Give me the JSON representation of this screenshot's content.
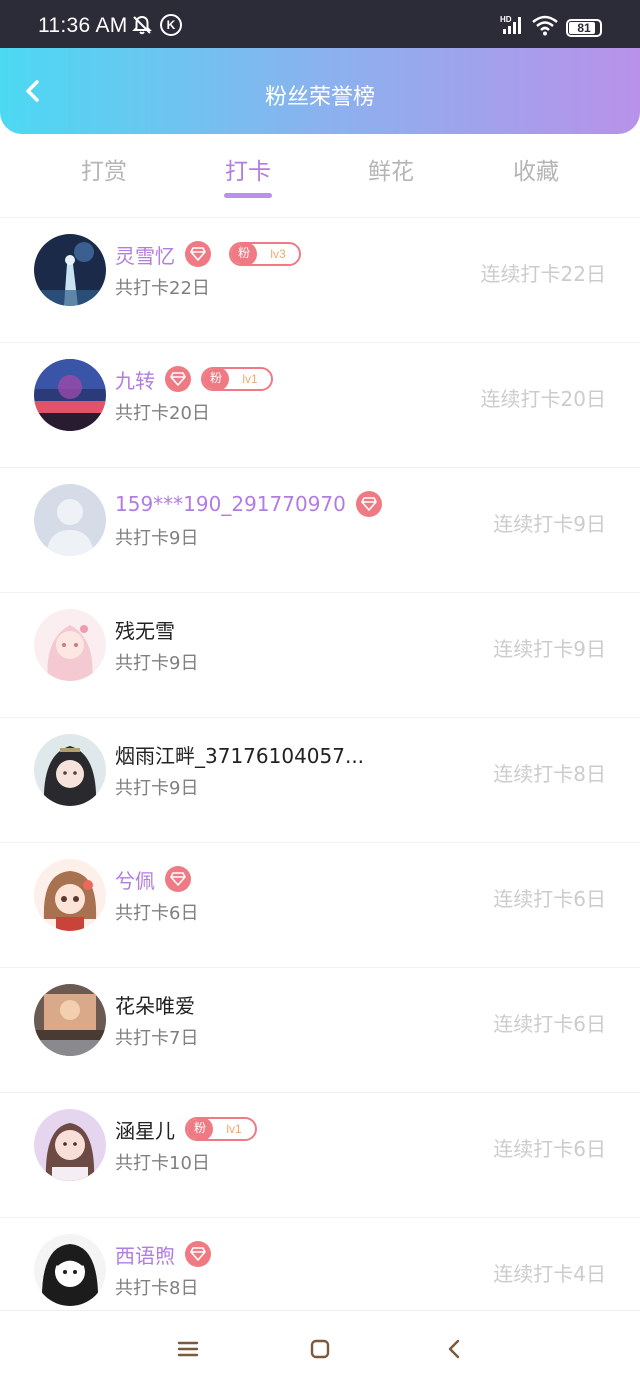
{
  "status_bar": {
    "time": "11:36 AM",
    "battery": "81",
    "battery_level": 0.81,
    "icons": [
      "bell-off-icon",
      "k-circle-icon",
      "hd-signal-icon",
      "wifi-icon",
      "battery-icon"
    ]
  },
  "header": {
    "title": "粉丝荣誉榜",
    "back_icon": "chevron-left-icon"
  },
  "tabs": [
    {
      "label": "打赏",
      "active": false
    },
    {
      "label": "打卡",
      "active": true
    },
    {
      "label": "鲜花",
      "active": false
    },
    {
      "label": "收藏",
      "active": false
    }
  ],
  "fans": [
    {
      "name": "灵雪忆",
      "vip": true,
      "diamond": true,
      "fan_badge": {
        "char": "粉",
        "level": "lv3"
      },
      "total": "共打卡22日",
      "streak": "连续打卡22日"
    },
    {
      "name": "九转",
      "vip": true,
      "diamond": true,
      "fan_badge": {
        "char": "粉",
        "level": "lv1"
      },
      "total": "共打卡20日",
      "streak": "连续打卡20日"
    },
    {
      "name": "159***190_291770970",
      "vip": true,
      "diamond": true,
      "fan_badge": null,
      "total": "共打卡9日",
      "streak": "连续打卡9日"
    },
    {
      "name": "残无雪",
      "vip": false,
      "diamond": false,
      "fan_badge": null,
      "total": "共打卡9日",
      "streak": "连续打卡9日"
    },
    {
      "name": "烟雨江畔_37176104057...",
      "vip": false,
      "diamond": false,
      "fan_badge": null,
      "total": "共打卡9日",
      "streak": "连续打卡8日"
    },
    {
      "name": "兮佩",
      "vip": true,
      "diamond": true,
      "fan_badge": null,
      "total": "共打卡6日",
      "streak": "连续打卡6日"
    },
    {
      "name": "花朵唯爱",
      "vip": false,
      "diamond": false,
      "fan_badge": null,
      "total": "共打卡7日",
      "streak": "连续打卡6日"
    },
    {
      "name": "涵星儿",
      "vip": false,
      "diamond": false,
      "fan_badge": {
        "char": "粉",
        "level": "lv1"
      },
      "total": "共打卡10日",
      "streak": "连续打卡6日"
    },
    {
      "name": "西语煦",
      "vip": true,
      "diamond": true,
      "fan_badge": null,
      "total": "共打卡8日",
      "streak": "连续打卡4日"
    }
  ],
  "nav_bar": {
    "icons": [
      "menu-icon",
      "home-square-icon",
      "back-triangle-icon"
    ]
  },
  "colors": {
    "header_gradient": [
      "#4cd9f2",
      "#8ab2ee",
      "#b892ea"
    ],
    "accent_purple": "#b27de1",
    "badge_red": "#f07a84",
    "muted_text": "#cccccc"
  }
}
